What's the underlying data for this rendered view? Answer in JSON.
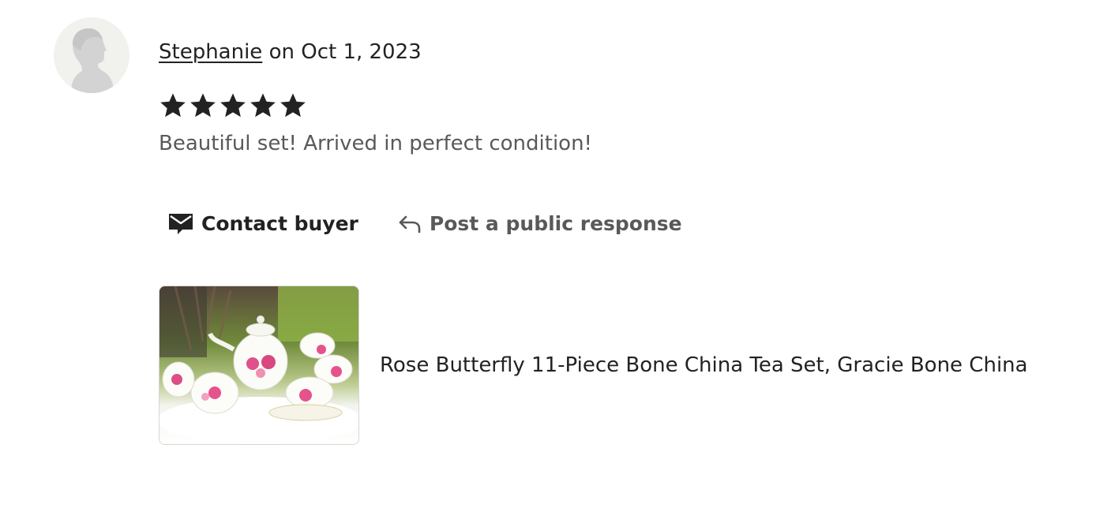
{
  "review": {
    "reviewer_name": "Stephanie",
    "date_text": " on Oct 1, 2023",
    "rating": 5,
    "rating_max": 5,
    "text": "Beautiful set! Arrived in perfect condition!"
  },
  "actions": {
    "contact_label": "Contact buyer",
    "respond_label": "Post a public response"
  },
  "listing": {
    "title": "Rose Butterfly 11-Piece Bone China Tea Set, Gracie Bone China"
  },
  "icons": {
    "avatar": "default-user-silhouette",
    "star": "star-filled-icon",
    "contact": "envelope-icon",
    "respond": "reply-arrow-icon"
  },
  "colors": {
    "text_primary": "#222222",
    "text_secondary": "#595959",
    "avatar_bg": "#f1f1ed",
    "avatar_figure": "#d3d3d3"
  }
}
